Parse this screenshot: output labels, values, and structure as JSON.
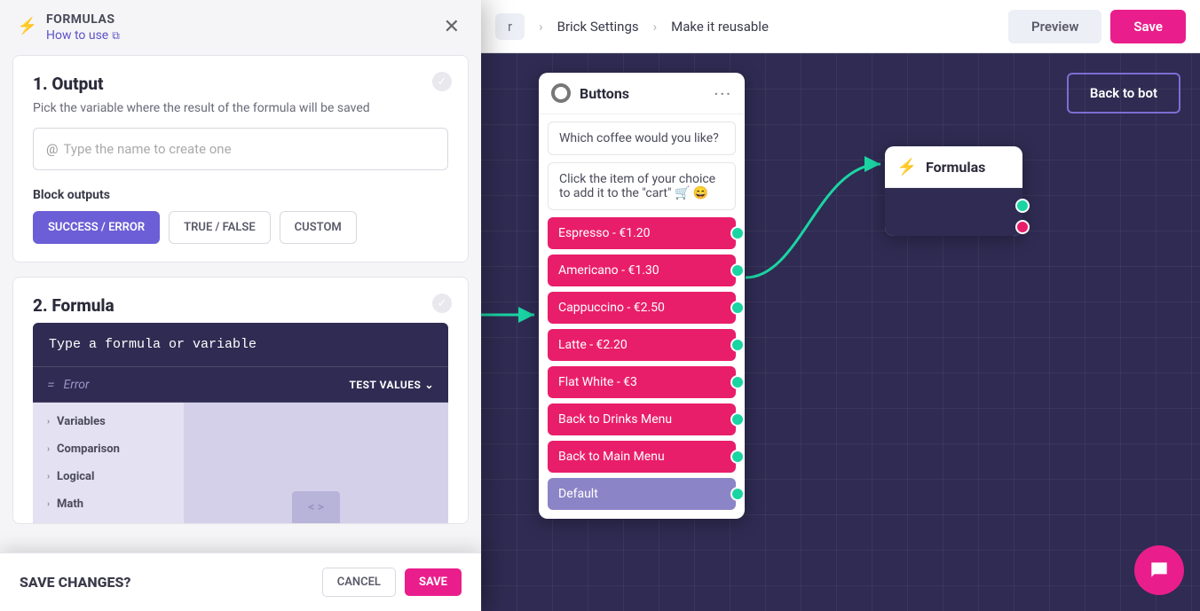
{
  "topbar": {
    "bc1_suffix": "r",
    "bc2": "Brick Settings",
    "bc3": "Make it reusable",
    "preview": "Preview",
    "save": "Save"
  },
  "canvas": {
    "back": "Back to bot",
    "buttons_card": {
      "title": "Buttons",
      "msg1": "Which coffee would you like?",
      "msg2": "Click the item of your choice to add it to the \"cart\" 🛒 😄",
      "choices": [
        "Espresso - €1.20",
        "Americano - €1.30",
        "Cappuccino - €2.50",
        "Latte - €2.20",
        "Flat White - €3",
        "Back to Drinks Menu",
        "Back to Main Menu"
      ],
      "default": "Default"
    },
    "formulas_card": {
      "title": "Formulas"
    }
  },
  "panel": {
    "header": {
      "title": "FORMULAS",
      "how": "How to use"
    },
    "output": {
      "title": "1. Output",
      "subtitle": "Pick the variable where the result of the formula will be saved",
      "placeholder": "Type the name to create one",
      "block_outputs_label": "Block outputs",
      "seg": [
        "SUCCESS / ERROR",
        "TRUE / FALSE",
        "CUSTOM"
      ]
    },
    "formula": {
      "title": "2. Formula",
      "prompt": "Type a formula or variable",
      "error": "Error",
      "test": "TEST VALUES",
      "cats": [
        "Variables",
        "Comparison",
        "Logical",
        "Math"
      ]
    },
    "savebar": {
      "q": "SAVE CHANGES?",
      "cancel": "CANCEL",
      "save": "SAVE"
    }
  }
}
